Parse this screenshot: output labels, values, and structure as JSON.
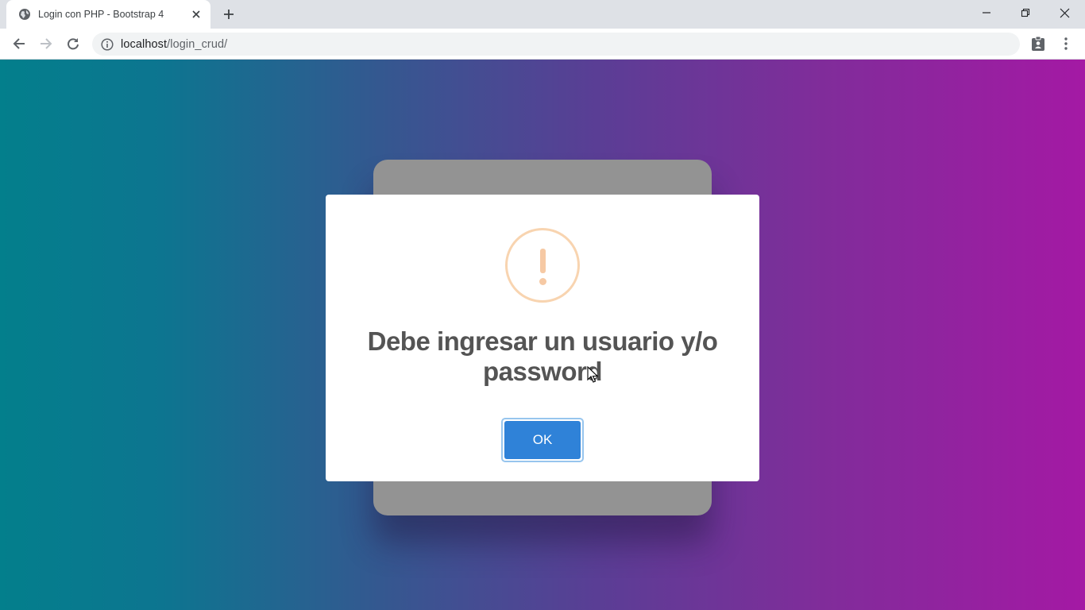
{
  "browser": {
    "tab_title": "Login con PHP - Bootstrap 4",
    "url_host": "localhost",
    "url_path": "/login_crud/",
    "icons": {
      "favicon": "globe-icon",
      "tab_close": "close-icon",
      "new_tab": "plus-icon",
      "back": "back-arrow-icon",
      "forward": "forward-arrow-icon",
      "reload": "reload-icon",
      "site_info": "info-icon",
      "extension": "clipboard-badge-icon",
      "menu": "kebab-menu-icon",
      "minimize": "minimize-icon",
      "restore": "restore-icon",
      "close_window": "close-icon"
    }
  },
  "alert": {
    "icon": "warning-icon",
    "title": "Debe ingresar un usuario y/o password",
    "ok_label": "OK"
  },
  "colors": {
    "gradient_start": "#037f8c",
    "gradient_end": "#a419a4",
    "ok_button": "#2f82d8",
    "warning": "#f8c59a"
  }
}
